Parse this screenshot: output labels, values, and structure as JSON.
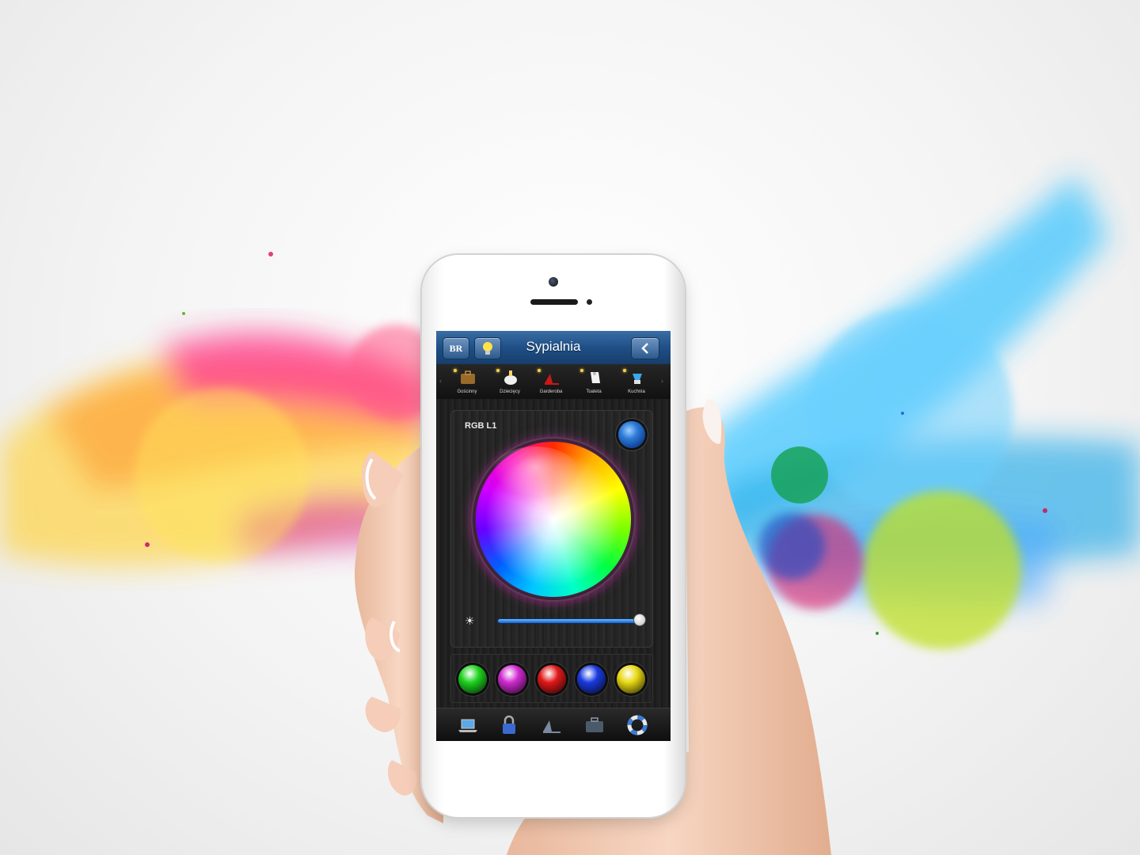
{
  "app": {
    "title": "Sypialnia",
    "logo_text": "BR",
    "bulb_icon": "bulb-icon",
    "back_icon": "chevron-left-icon"
  },
  "rooms": [
    {
      "label": "Gościnny",
      "icon": "briefcase-icon"
    },
    {
      "label": "Dziecięcy",
      "icon": "baby-bottle-icon"
    },
    {
      "label": "Garderoba",
      "icon": "high-heel-icon"
    },
    {
      "label": "Toaleta",
      "icon": "toilet-paper-icon"
    },
    {
      "label": "Kuchnia",
      "icon": "mixer-icon"
    }
  ],
  "panel": {
    "label": "RGB L1",
    "status_color": "#2d7ad8",
    "brightness_icon": "sun-icon",
    "brightness_level": 1.0
  },
  "presets": [
    {
      "name": "green",
      "color": "#1ed31e"
    },
    {
      "name": "magenta",
      "color": "#d02ad0"
    },
    {
      "name": "red",
      "color": "#e01818"
    },
    {
      "name": "blue",
      "color": "#1a3ae0"
    },
    {
      "name": "yellow",
      "color": "#e8d812"
    }
  ],
  "bottom_nav": [
    {
      "icon": "laptop-icon"
    },
    {
      "icon": "lock-icon"
    },
    {
      "icon": "high-heel-icon"
    },
    {
      "icon": "suitcase-icon"
    },
    {
      "icon": "lifebuoy-icon"
    }
  ]
}
